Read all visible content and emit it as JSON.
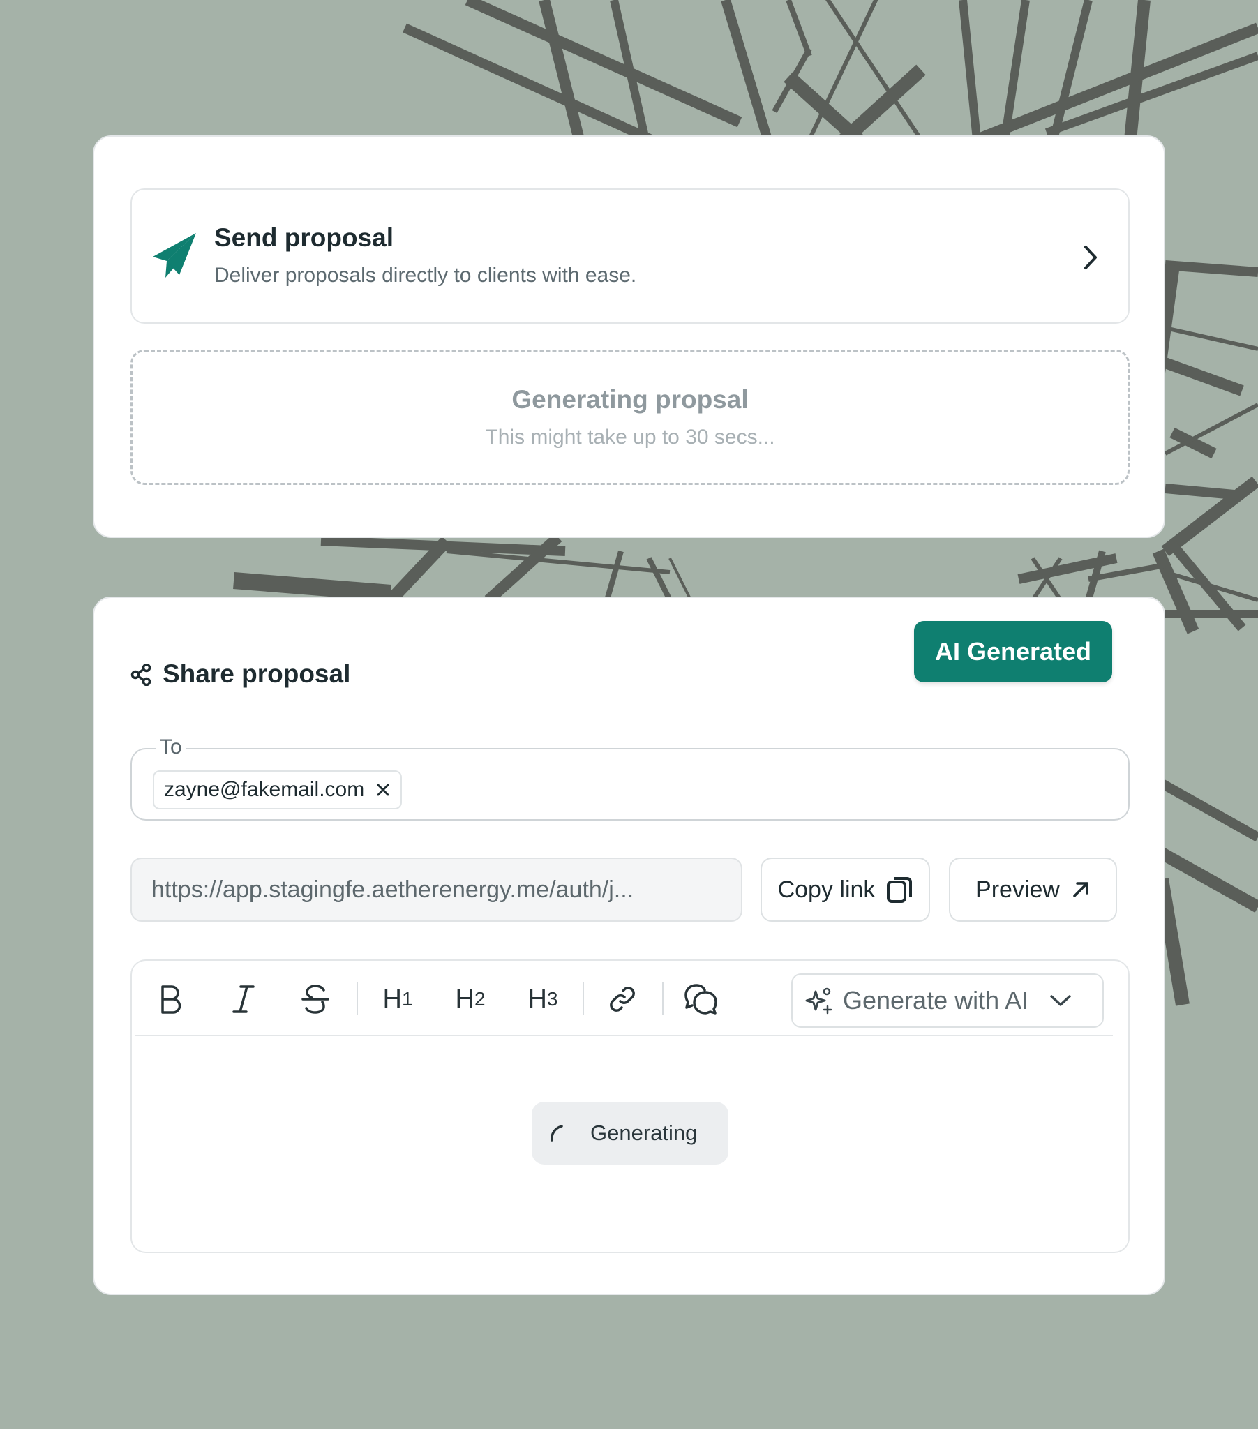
{
  "colors": {
    "background": "#a5b2a8",
    "accent": "#0f7f70",
    "card": "#ffffff",
    "art": "#5a5e59"
  },
  "send_card": {
    "title": "Send proposal",
    "subtitle": "Deliver proposals directly to clients with ease.",
    "icon": "paper-plane-icon",
    "action_icon": "chevron-right-icon"
  },
  "generating_card": {
    "title": "Generating propsal",
    "subtitle": "This might take up to 30 secs..."
  },
  "share": {
    "title": "Share proposal",
    "icon": "share-icon",
    "badge": "AI Generated",
    "to_label": "To",
    "recipients": [
      "zayne@fakemail.com"
    ],
    "link_value": "https://app.stagingfe.aetherenergy.me/auth/j...",
    "copy_label": "Copy link",
    "preview_label": "Preview"
  },
  "editor": {
    "toolbar": [
      {
        "name": "bold",
        "icon": "bold-icon"
      },
      {
        "name": "italic",
        "icon": "italic-icon"
      },
      {
        "name": "strikethrough",
        "icon": "strikethrough-icon"
      },
      {
        "name": "heading-1",
        "label": "H",
        "sub": "1"
      },
      {
        "name": "heading-2",
        "label": "H",
        "sub": "2"
      },
      {
        "name": "heading-3",
        "label": "H",
        "sub": "3"
      },
      {
        "name": "link",
        "icon": "link-icon"
      },
      {
        "name": "comment",
        "icon": "comment-icon"
      }
    ],
    "generate_label": "Generate with AI",
    "status_label": "Generating"
  }
}
